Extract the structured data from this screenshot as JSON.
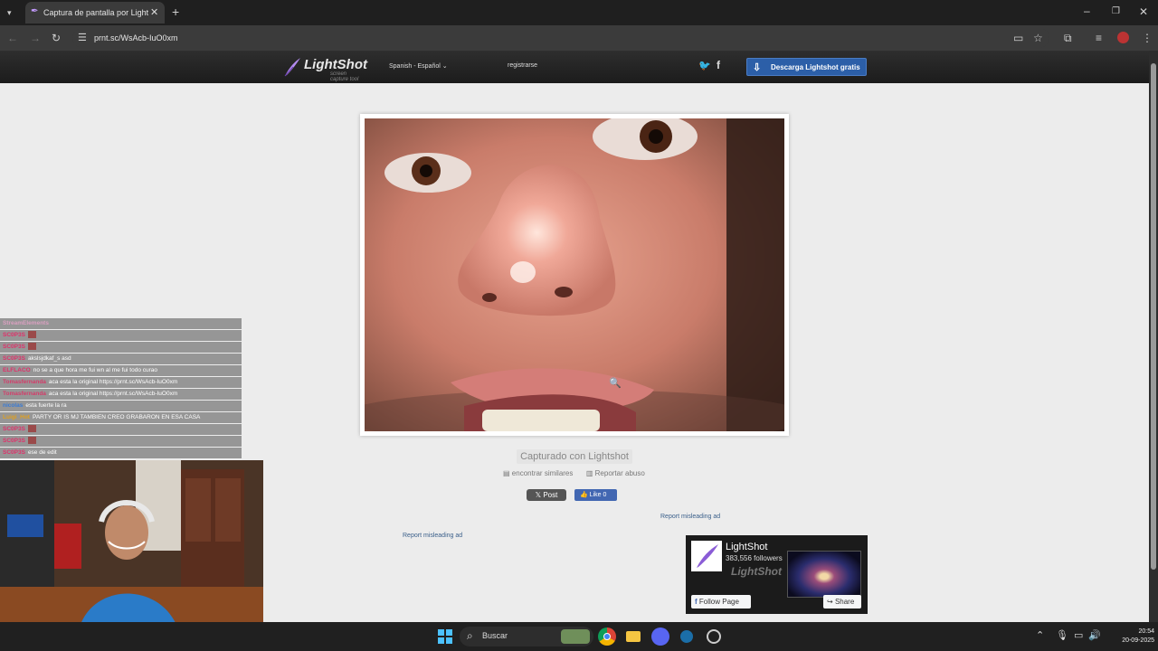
{
  "browser": {
    "tab_title": "Captura de pantalla por Lightshot",
    "url": "prnt.sc/WsAcb-IuO0xm"
  },
  "lightshot": {
    "logo_name": "LightShot",
    "logo_sub": "screen capture tool",
    "language": "Spanish - Español",
    "register": "registrarse",
    "download_button": "Descarga Lightshot gratis",
    "captured_with": "Capturado con Lightshot",
    "find_similar": "encontrar similares",
    "report_abuse": "Reportar abuso",
    "x_post": "Post",
    "fb_like": "Like 0",
    "report_ad_1": "Report misleading ad",
    "report_ad_2": "Report misleading ad",
    "fb_page_name": "LightShot",
    "fb_followers": "383,556 followers",
    "fb_follow": "Follow Page",
    "fb_share": "Share",
    "fb_watermark": "LightShot"
  },
  "chat": {
    "messages": [
      {
        "user": "StreamElements",
        "text": "",
        "color": "#d9a0c0"
      },
      {
        "user": "SC0P3S",
        "text": "",
        "emote": true,
        "color": "#e0306a"
      },
      {
        "user": "SC0P3S",
        "text": "",
        "emote": true,
        "color": "#e0306a"
      },
      {
        "user": "SC0P3S",
        "text": "akslsjdkaf_s asd",
        "color": "#e0306a"
      },
      {
        "user": "ELFLACO",
        "text": "no se a que hora me fui wn al me fui todo curao",
        "color": "#e0306a"
      },
      {
        "user": "Tomasfernanda",
        "text": "aca esta la original https://prnt.sc/WsAcb-IuO0xm",
        "color": "#d43c6a"
      },
      {
        "user": "Tomasfernanda",
        "text": "aca esta la original https://prnt.sc/WsAcb-IuO0xm",
        "color": "#d43c6a"
      },
      {
        "user": "nicolas",
        "text": "esta fuerte la ra",
        "color": "#3a7bd5"
      },
      {
        "user": "Luigi_Hot",
        "text": "PARTY OR IS MJ TAMBIEN CREO GRABARON EN ESA CASA",
        "color": "#e0a020"
      },
      {
        "user": "SC0P3S",
        "text": "",
        "emote": true,
        "color": "#e0306a"
      },
      {
        "user": "SC0P3S",
        "text": "",
        "emote": true,
        "color": "#e0306a"
      },
      {
        "user": "SC0P3S",
        "text": "ese de edit",
        "color": "#e0306a"
      }
    ]
  },
  "taskbar": {
    "search_label": "Buscar",
    "time": "20:54",
    "date": "20-09-2025"
  },
  "colors": {
    "download_button": "#2c5fa8",
    "fb_blue": "#4267b2",
    "page_bg": "#ececec",
    "header_bg": "#1c1c1c"
  }
}
